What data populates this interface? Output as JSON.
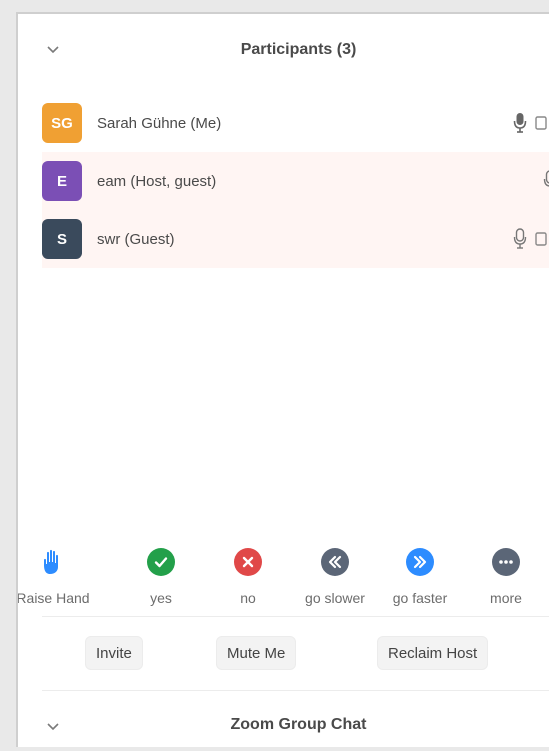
{
  "participants_panel": {
    "title": "Participants (3)",
    "collapse_icon": "chevron-down-icon"
  },
  "participants": [
    {
      "initials": "SG",
      "name": "Sarah Gühne (Me)",
      "avatar_color": "#f0a033",
      "highlight": false,
      "icons": [
        "microphone-icon",
        "video-icon"
      ]
    },
    {
      "initials": "E",
      "name": "eam (Host, guest)",
      "avatar_color": "#7b4fb5",
      "highlight": true,
      "icons": [
        "microphone-icon"
      ]
    },
    {
      "initials": "S",
      "name": "swr (Guest)",
      "avatar_color": "#3a4a5c",
      "highlight": true,
      "icons": [
        "microphone-icon",
        "video-icon"
      ]
    }
  ],
  "reactions": [
    {
      "label": "Raise Hand",
      "icon": "raise-hand-icon",
      "color": "#2d8cff"
    },
    {
      "label": "yes",
      "icon": "check-icon",
      "color": "#23a04a"
    },
    {
      "label": "no",
      "icon": "close-icon",
      "color": "#e04848"
    },
    {
      "label": "go slower",
      "icon": "rewind-icon",
      "color": "#5b6677"
    },
    {
      "label": "go faster",
      "icon": "fast-forward-icon",
      "color": "#2d8cff"
    },
    {
      "label": "more",
      "icon": "more-icon",
      "color": "#5b6677"
    }
  ],
  "buttons": {
    "invite": "Invite",
    "mute_me": "Mute Me",
    "reclaim_host": "Reclaim Host"
  },
  "chat_panel": {
    "title": "Zoom Group Chat",
    "collapse_icon": "chevron-down-icon"
  }
}
